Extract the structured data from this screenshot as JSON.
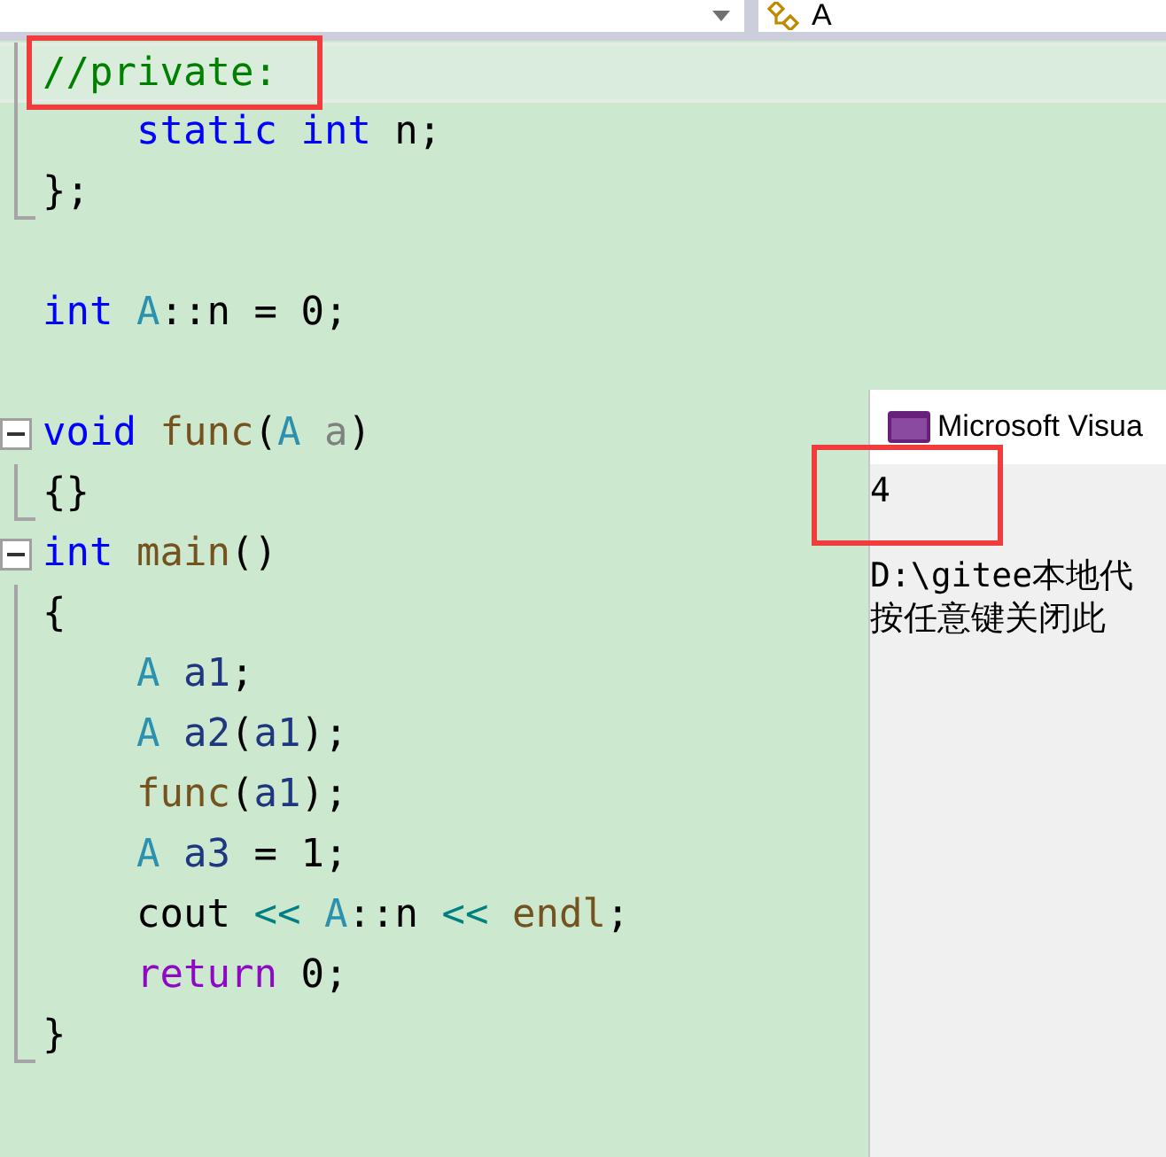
{
  "navigation_bar": {
    "member_dropdown": {
      "value": "A"
    }
  },
  "code_lines": [
    {
      "kind": "inner",
      "current": true,
      "tokens": [
        {
          "t": "//private:",
          "color": "#008000"
        }
      ]
    },
    {
      "kind": "inner",
      "current": false,
      "tokens": [
        {
          "t": "    static",
          "color": "#0000ff"
        },
        {
          "t": " int",
          "color": "#0000ff"
        },
        {
          "t": " n;",
          "color": "#000000"
        }
      ]
    },
    {
      "kind": "end",
      "current": false,
      "tokens": [
        {
          "t": "};",
          "color": "#000000"
        }
      ]
    },
    {
      "kind": "blank",
      "current": false
    },
    {
      "kind": "plain",
      "current": false,
      "tokens": [
        {
          "t": "int",
          "color": "#0000ff"
        },
        {
          "t": " A",
          "color": "#2b91af"
        },
        {
          "t": "::n = 0;",
          "color": "#000000"
        }
      ]
    },
    {
      "kind": "blank",
      "current": false
    },
    {
      "kind": "start",
      "current": false,
      "tokens": [
        {
          "t": "void",
          "color": "#0000ff"
        },
        {
          "t": " func",
          "color": "#74531f"
        },
        {
          "t": "(",
          "color": "#000000"
        },
        {
          "t": "A",
          "color": "#2b91af"
        },
        {
          "t": " a",
          "color": "#808080"
        },
        {
          "t": ")",
          "color": "#000000"
        }
      ]
    },
    {
      "kind": "end",
      "current": false,
      "tokens": [
        {
          "t": "{}",
          "color": "#000000"
        }
      ]
    },
    {
      "kind": "start",
      "current": false,
      "tokens": [
        {
          "t": "int",
          "color": "#0000ff"
        },
        {
          "t": " main",
          "color": "#74531f"
        },
        {
          "t": "()",
          "color": "#000000"
        }
      ]
    },
    {
      "kind": "inner",
      "current": false,
      "tokens": [
        {
          "t": "{",
          "color": "#000000"
        }
      ]
    },
    {
      "kind": "inner",
      "current": false,
      "tokens": [
        {
          "t": "    A",
          "color": "#2b91af"
        },
        {
          "t": " a1",
          "color": "#1f377f"
        },
        {
          "t": ";",
          "color": "#000000"
        }
      ]
    },
    {
      "kind": "inner",
      "current": false,
      "tokens": [
        {
          "t": "    A",
          "color": "#2b91af"
        },
        {
          "t": " a2",
          "color": "#1f377f"
        },
        {
          "t": "(",
          "color": "#000000"
        },
        {
          "t": "a1",
          "color": "#1f377f"
        },
        {
          "t": ");",
          "color": "#000000"
        }
      ]
    },
    {
      "kind": "inner",
      "current": false,
      "tokens": [
        {
          "t": "    func",
          "color": "#74531f"
        },
        {
          "t": "(",
          "color": "#000000"
        },
        {
          "t": "a1",
          "color": "#1f377f"
        },
        {
          "t": ");",
          "color": "#000000"
        }
      ]
    },
    {
      "kind": "inner",
      "current": false,
      "tokens": [
        {
          "t": "    A",
          "color": "#2b91af"
        },
        {
          "t": " a3",
          "color": "#1f377f"
        },
        {
          "t": " = 1;",
          "color": "#000000"
        }
      ]
    },
    {
      "kind": "inner",
      "current": false,
      "tokens": [
        {
          "t": "    cout",
          "color": "#000000"
        },
        {
          "t": " <<",
          "color": "#008080"
        },
        {
          "t": " A",
          "color": "#2b91af"
        },
        {
          "t": "::n",
          "color": "#000000"
        },
        {
          "t": " <<",
          "color": "#008080"
        },
        {
          "t": " endl",
          "color": "#74531f"
        },
        {
          "t": ";",
          "color": "#000000"
        }
      ]
    },
    {
      "kind": "inner",
      "current": false,
      "tokens": [
        {
          "t": "    return",
          "color": "#8f08c4"
        },
        {
          "t": " 0;",
          "color": "#000000"
        }
      ]
    },
    {
      "kind": "end",
      "current": false,
      "tokens": [
        {
          "t": "}",
          "color": "#000000"
        }
      ]
    }
  ],
  "console_window": {
    "title": "Microsoft Visua",
    "program_output": "4",
    "exit_lines": [
      "D:\\gitee本地代",
      "按任意键关闭此"
    ]
  }
}
